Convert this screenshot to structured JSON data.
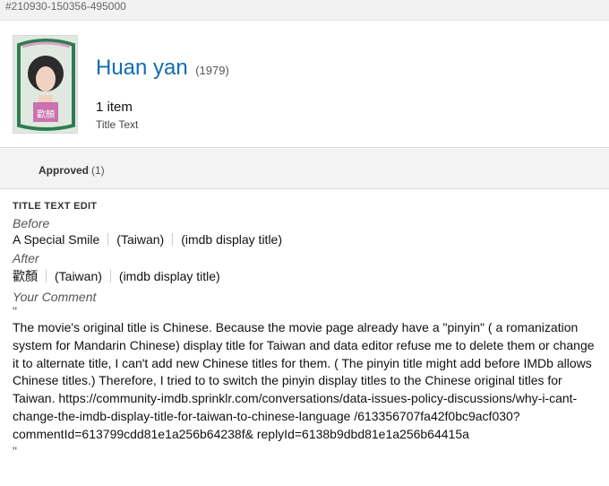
{
  "topbar": {
    "id_text": "#210930-150356-495000"
  },
  "header": {
    "title": "Huan yan",
    "year": "(1979)",
    "count": "1 item",
    "type": "Title Text"
  },
  "status": {
    "label": "Approved",
    "count": "(1)"
  },
  "edit": {
    "section_title": "TITLE TEXT EDIT",
    "before_label": "Before",
    "before": {
      "title": "A Special Smile",
      "region": "(Taiwan)",
      "note": "(imdb display title)"
    },
    "after_label": "After",
    "after": {
      "title": "歡顏",
      "region": "(Taiwan)",
      "note": "(imdb display title)"
    },
    "comment_label": "Your Comment",
    "open_quote": "\"",
    "close_quote": "\"",
    "comment": "The movie's original title is Chinese. Because the movie page already have a \"pinyin\" ( a romanization system for Mandarin Chinese) display title for Taiwan and data editor refuse me to delete them or change it to alternate title, I can't add new Chinese titles for them. ( The pinyin title might add before IMDb allows Chinese titles.) Therefore, I tried to to switch the pinyin display titles to the Chinese original titles for Taiwan. https://community-imdb.sprinklr.com/conversations/data-issues-policy-discussions/why-i-cant-change-the-imdb-display-title-for-taiwan-to-chinese-language /613356707fa42f0bc9acf030?commentId=613799cdd81e1a256b64238f& replyId=6138b9dbd81e1a256b64415a"
  }
}
